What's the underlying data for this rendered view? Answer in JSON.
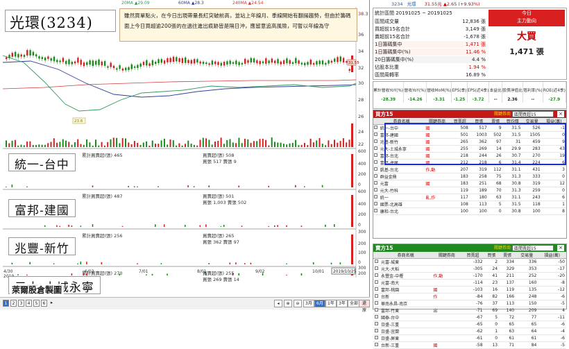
{
  "legend": {
    "ma20": "20MA ▲29.09",
    "ma60": "60MA ▲28.3",
    "ma240": "240MA ▲24.54"
  },
  "stock_title": "光環(3234)",
  "note": "雖然買單點火，在今日出現帶量長紅突破前高，並站上年線月、季線開始有翻揚趨勢，但由於籌碼面上今日買超逾200張的在過往進出痕跡皆是隔日沖，應留意追高風險，可暫以年線為守",
  "price_axis": [
    "38.3",
    "36",
    "34",
    "32",
    "30",
    "28",
    "26",
    "24",
    "22"
  ],
  "price_marker": "31.55",
  "price_flag": "23.6",
  "brokers": [
    {
      "caption": "統一-台中",
      "buy_label": "累計買賣超(張) 465",
      "net": "買賣超(張) 508",
      "detail": "買張 517 賣張 9",
      "axis": [
        "600",
        "400",
        "200",
        "0"
      ]
    },
    {
      "caption": "富邦-建國",
      "buy_label": "累計買賣超(張) 487",
      "net": "買賣超(張) 501",
      "detail": "買張 1,003 賣張 502",
      "axis": [
        "600",
        "400",
        "200",
        "0"
      ]
    },
    {
      "caption": "兆豐-新竹",
      "buy_label": "累計買賣超(張) 256",
      "net": "買賣超(張) 265",
      "detail": "買張 362 賣張 97",
      "axis": [
        "300",
        "200",
        "100",
        "0"
      ]
    },
    {
      "caption": "元大-土城永寧",
      "buy_label": "累計買賣超(張) 270",
      "net": "買賣超(張) 255",
      "detail": "買張 269 賣張 14",
      "axis": [
        "300",
        "200",
        "100",
        "0"
      ]
    }
  ],
  "x_axis": {
    "year": "4/30\n2019",
    "ticks": [
      "6/03",
      "7/01",
      "8/01",
      "9/02",
      "10/01"
    ],
    "end_date": "2019/10/25"
  },
  "factory_mark": "萊爾股倉製圖",
  "pages": [
    "1",
    "2",
    "3",
    "4",
    "5",
    "6"
  ],
  "zoom_buttons": [
    "3月",
    "6月",
    "1年",
    "3年",
    "全部",
    "還原"
  ],
  "top_price": {
    "code": "3234",
    "name": "光環",
    "price": "31.55元 ▲2.65 (+9.93%)"
  },
  "stats": {
    "period": "統計區間 20191025 ~ 20191025",
    "rows": [
      [
        "區間成交量",
        "12,836 張"
      ],
      [
        "買超前15名合計",
        "3,149 張"
      ],
      [
        "賣超前15名合計",
        "-1,678 張"
      ],
      [
        "1日籌碼集中",
        "1,471 張"
      ],
      [
        "1日籌碼集中(%)",
        "11.46 %"
      ],
      [
        "20日籌碼集中(%)",
        "4.4 %"
      ],
      [
        "佔股本比重",
        "1.94 %"
      ],
      [
        "區間周轉率",
        "16.89 %"
      ]
    ],
    "today_label": "今日",
    "direction_label": "主力動向",
    "verdict": "大買",
    "verdict_count": "1,471 張"
  },
  "fin": {
    "headers": [
      "累計營收YoY(%)",
      "營收YoY(%)",
      "營收MoM(%)",
      "EPS(季)",
      "EPS(近4季)",
      "本益比",
      "股價淨值比",
      "殖利率(%)",
      "ROE(近4季)"
    ],
    "values": [
      "-28.39",
      "-14.26",
      "-3.31",
      "-1.25",
      "-3.72",
      "--",
      "2.36",
      "--",
      "-27.9"
    ]
  },
  "buy_panel": {
    "title": "買方15",
    "check": "關鍵券商",
    "select": "區間買超15",
    "headers": [
      "",
      "券商名稱",
      "關鍵券商",
      "買賣超",
      "買張",
      "賣張",
      "買均價",
      "交易量",
      "損益(萬)"
    ],
    "rows": [
      [
        "統一-台中",
        "國",
        "508",
        "517",
        "9",
        "31.5",
        "526",
        "-1"
      ],
      [
        "富邦-建國",
        "國",
        "501",
        "1003",
        "502",
        "31.5",
        "1505",
        "0"
      ],
      [
        "兆豐-新竹",
        "國",
        "265",
        "362",
        "97",
        "31",
        "459",
        "9"
      ],
      [
        "元大-土城永寧",
        "國",
        "255",
        "269",
        "14",
        "29.9",
        "283",
        "43"
      ],
      [
        "富邦-台北",
        "國",
        "218",
        "244",
        "26",
        "30.7",
        "270",
        "19"
      ],
      [
        "富邦-虎尾",
        "國",
        "212",
        "218",
        "6",
        "31.4",
        "224",
        "6"
      ],
      [
        "凱基-台北",
        "作,動",
        "207",
        "319",
        "112",
        "31.1",
        "431",
        "3"
      ],
      [
        "群益金鼎",
        "",
        "183",
        "258",
        "75",
        "31.3",
        "333",
        "0"
      ],
      [
        "元富",
        "國",
        "183",
        "251",
        "68",
        "30.8",
        "319",
        "12"
      ],
      [
        "元大-竹科",
        "",
        "119",
        "189",
        "70",
        "31.3",
        "259",
        "0"
      ],
      [
        "統一",
        "亂,作",
        "117",
        "180",
        "63",
        "31.1",
        "243",
        "6"
      ],
      [
        "國票-北高雄",
        "",
        "108",
        "113",
        "5",
        "31.5",
        "118",
        "1"
      ],
      [
        "康和-台北",
        "",
        "100",
        "100",
        "0",
        "30.8",
        "100",
        "8"
      ]
    ]
  },
  "sell_panel": {
    "title": "賣方15",
    "check": "關鍵券商",
    "select": "區間賣超15",
    "headers": [
      "",
      "券商名稱",
      "關鍵券商",
      "買賣超",
      "買張",
      "賣張",
      "交易量",
      "損益(萬)"
    ],
    "rows": [
      [
        "元富-城東",
        "",
        "-332",
        "2",
        "334",
        "336",
        "-50"
      ],
      [
        "元大-大稻",
        "",
        "-305",
        "24",
        "329",
        "353",
        "-17"
      ],
      [
        "永豐金-中壢",
        "作,動",
        "-170",
        "41",
        "211",
        "252",
        "-20"
      ],
      [
        "元富-南大",
        "",
        "-114",
        "23",
        "137",
        "160",
        "-8"
      ],
      [
        "富邦-桃園",
        "國",
        "-103",
        "16",
        "119",
        "135",
        "-12"
      ],
      [
        "台新",
        "作",
        "-84",
        "82",
        "166",
        "248",
        "-6"
      ],
      [
        "華南永昌-南京",
        "",
        "-76",
        "37",
        "113",
        "150",
        "-5"
      ],
      [
        "富邦-竹東",
        "出",
        "-71",
        "69",
        "140",
        "209",
        "4"
      ],
      [
        "國泰-台中",
        "",
        "-67",
        "5",
        "72",
        "77",
        "-11"
      ],
      [
        "日盛-三重",
        "",
        "-65",
        "0",
        "65",
        "65",
        "-6"
      ],
      [
        "日盛-宜蘭",
        "",
        "-62",
        "1",
        "63",
        "64",
        "-4"
      ],
      [
        "日盛-屏東",
        "",
        "-61",
        "0",
        "61",
        "61",
        "-6"
      ],
      [
        "台新-三重",
        "國",
        "-58",
        "13",
        "71",
        "84",
        "-5"
      ]
    ]
  },
  "colors": {
    "accent_red": "#d92020",
    "buy_header": "#c41818",
    "sell_header": "#1f8a1f",
    "highlight": "#1a2fc7"
  }
}
